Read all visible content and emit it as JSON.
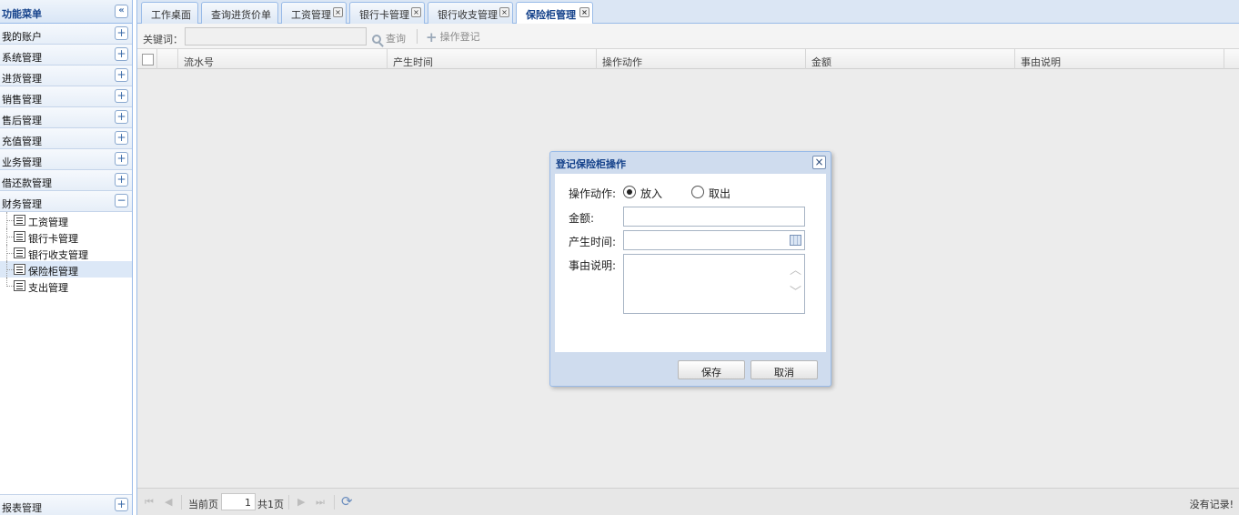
{
  "sidebar": {
    "title": "功能菜单",
    "collapse_glyph": "«",
    "sections": [
      {
        "label": "我的账户",
        "toggle": "+"
      },
      {
        "label": "系统管理",
        "toggle": "+"
      },
      {
        "label": "进货管理",
        "toggle": "+"
      },
      {
        "label": "销售管理",
        "toggle": "+"
      },
      {
        "label": "售后管理",
        "toggle": "+"
      },
      {
        "label": "充值管理",
        "toggle": "+"
      },
      {
        "label": "业务管理",
        "toggle": "+"
      },
      {
        "label": "借还款管理",
        "toggle": "+"
      },
      {
        "label": "财务管理",
        "toggle": "−"
      }
    ],
    "finance_items": [
      {
        "label": "工资管理"
      },
      {
        "label": "银行卡管理"
      },
      {
        "label": "银行收支管理"
      },
      {
        "label": "保险柜管理"
      },
      {
        "label": "支出管理"
      }
    ],
    "footer": {
      "label": "报表管理",
      "toggle": "+"
    }
  },
  "tabs": [
    {
      "label": "工作桌面"
    },
    {
      "label": "查询进货价单"
    },
    {
      "label": "工资管理"
    },
    {
      "label": "银行卡管理"
    },
    {
      "label": "银行收支管理"
    },
    {
      "label": "保险柜管理"
    }
  ],
  "tab_close_glyph": "×",
  "toolbar": {
    "keyword_label": "关键词：",
    "keyword_value": "",
    "search_label": "查询",
    "register_label": "操作登记"
  },
  "grid": {
    "columns": [
      "流水号",
      "产生时间",
      "操作动作",
      "金额",
      "事由说明"
    ]
  },
  "pager": {
    "first": "⏮",
    "prev": "◀",
    "current_label": "当前页",
    "page_value": "1",
    "total_label": "共1页",
    "next": "▶",
    "last": "⏭",
    "refresh": "⟳",
    "status": "没有记录!"
  },
  "dialog": {
    "title": "登记保险柜操作",
    "close_glyph": "×",
    "action_label": "操作动作:",
    "option_in": "放入",
    "option_out": "取出",
    "amount_label": "金额:",
    "time_label": "产生时间:",
    "reason_label": "事由说明:",
    "save_label": "保存",
    "cancel_label": "取消"
  },
  "colors": {
    "accent": "#15428b",
    "border": "#99bbe8",
    "active_item": "#dce8f7"
  }
}
